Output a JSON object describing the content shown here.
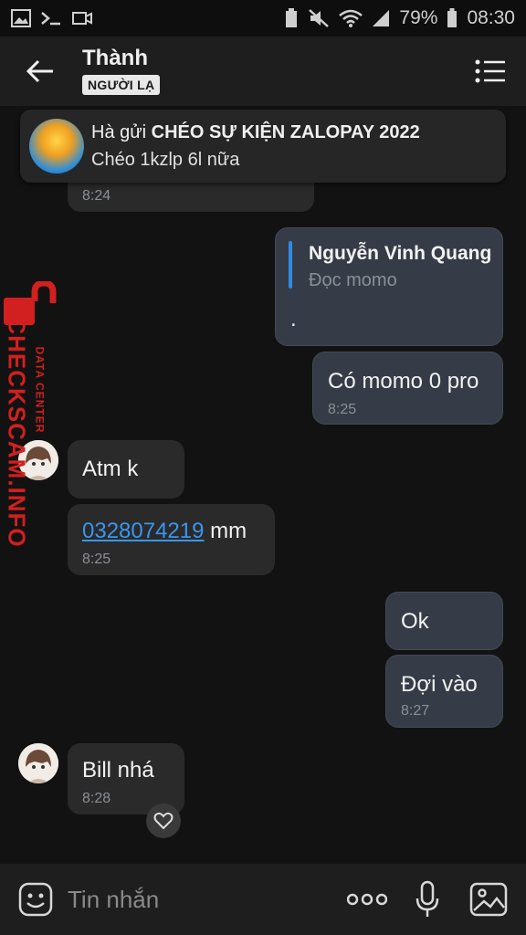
{
  "status": {
    "battery": "79%",
    "time": "08:30"
  },
  "header": {
    "title": "Thành",
    "badge": "NGƯỜI LẠ"
  },
  "pinned": {
    "sender_prefix": "Hà gửi ",
    "headline": "CHÉO SỰ KIỆN ZALOPAY 2022",
    "subtitle": "Chéo 1kzlp 6l nữa"
  },
  "messages": [
    {
      "time": "8:24"
    },
    {
      "reply_author": "Nguyễn Vinh Quang",
      "reply_text": "Đọc momo",
      "text": "."
    },
    {
      "text": "Có momo 0 pro",
      "time": "8:25"
    },
    {
      "text": "Atm k"
    },
    {
      "link": "0328074219",
      "suffix": " mm",
      "time": "8:25"
    },
    {
      "text": "Ok"
    },
    {
      "text": "Đợi vào",
      "time": "8:27"
    },
    {
      "text": "Bill nhá",
      "time": "8:28"
    }
  ],
  "watermark": {
    "brand": "CHECKSCAM.INFO",
    "sub": "DATA CENTER"
  },
  "composer": {
    "placeholder": "Tin nhắn"
  },
  "icons": {
    "back": "arrow-left-icon",
    "menu": "list-menu-icon",
    "emoji": "emoji-icon",
    "more": "more-dots-icon",
    "mic": "microphone-icon",
    "image": "image-icon",
    "heart": "heart-icon"
  },
  "colors": {
    "link": "#3a96ee",
    "reply_bar": "#2e8ae6",
    "watermark": "#d21f1f"
  }
}
